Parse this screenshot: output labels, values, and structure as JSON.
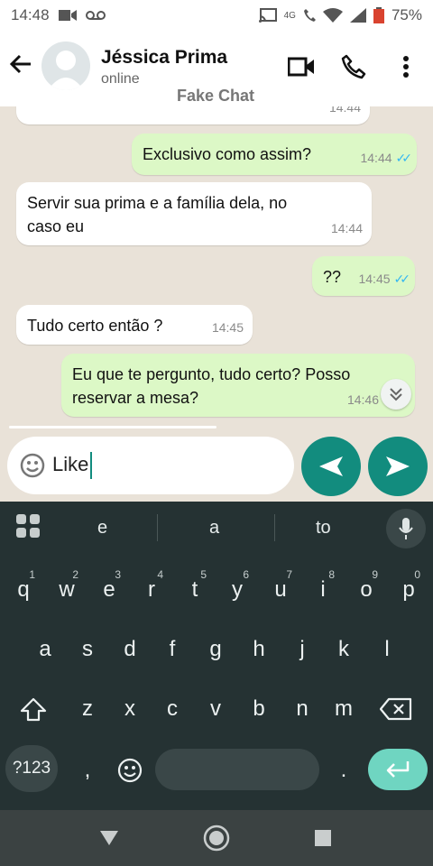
{
  "status_bar": {
    "time": "14:48",
    "battery": "75%",
    "network": "4G"
  },
  "header": {
    "contact_name": "Jéssica Prima",
    "contact_status": "online",
    "overlay_label": "Fake Chat"
  },
  "messages": [
    {
      "direction": "in",
      "text": "",
      "time": "14:44"
    },
    {
      "direction": "out",
      "text": "Exclusivo como assim?",
      "time": "14:44",
      "read": true
    },
    {
      "direction": "in",
      "text": "Servir sua prima e a família dela, no caso eu",
      "time": "14:44"
    },
    {
      "direction": "out",
      "text": "??",
      "time": "14:45",
      "read": true
    },
    {
      "direction": "in",
      "text": "Tudo certo então ?",
      "time": "14:45"
    },
    {
      "direction": "out",
      "text": "Eu que te pergunto, tudo certo? Posso reservar a mesa?",
      "time": "14:46",
      "read": false
    }
  ],
  "composer": {
    "text": "Like"
  },
  "keyboard": {
    "suggestions": [
      "e",
      "a",
      "to"
    ],
    "row1": [
      "q",
      "w",
      "e",
      "r",
      "t",
      "y",
      "u",
      "i",
      "o",
      "p"
    ],
    "row1_hints": [
      "1",
      "2",
      "3",
      "4",
      "5",
      "6",
      "7",
      "8",
      "9",
      "0"
    ],
    "row2": [
      "a",
      "s",
      "d",
      "f",
      "g",
      "h",
      "j",
      "k",
      "l"
    ],
    "row3": [
      "z",
      "x",
      "c",
      "v",
      "b",
      "n",
      "m"
    ],
    "symbols_label": "?123",
    "comma": ",",
    "period": "."
  },
  "icons": {
    "back": "arrow-left-icon",
    "video": "video-camera-icon",
    "call": "phone-icon",
    "menu": "more-vert-icon",
    "emoji": "emoji-icon",
    "send": "send-icon",
    "backward": "send-left-icon",
    "mic": "mic-icon"
  },
  "colors": {
    "accent": "#128c7e",
    "outgoing": "#dcf8c6",
    "incoming": "#ffffff",
    "chat_bg": "#e9e2d8",
    "keyboard_bg": "#253233",
    "read_ticks": "#34b7f1"
  }
}
